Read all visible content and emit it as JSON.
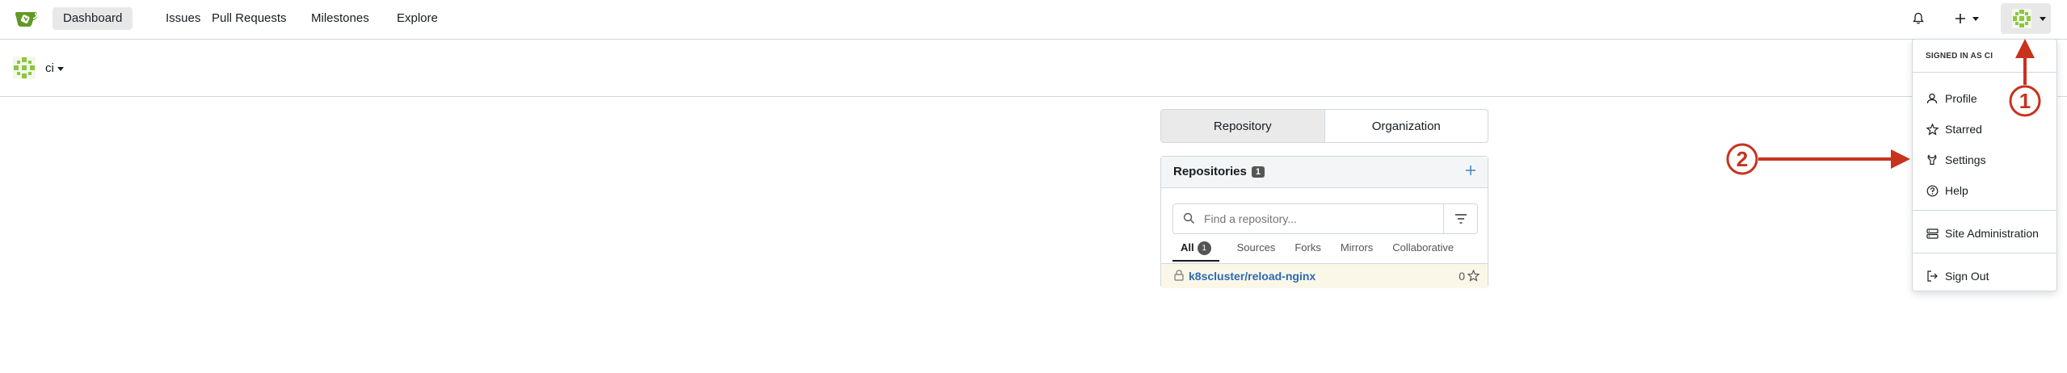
{
  "nav": {
    "items": [
      {
        "label": "Dashboard",
        "active": true
      },
      {
        "label": "Issues"
      },
      {
        "label": "Pull Requests"
      },
      {
        "label": "Milestones"
      },
      {
        "label": "Explore"
      }
    ],
    "icons": {
      "notifications": "bell-icon",
      "create": "plus-icon",
      "avatar": "user-avatar"
    }
  },
  "context": {
    "user": "ci"
  },
  "tabs": [
    {
      "label": "Repository",
      "active": true
    },
    {
      "label": "Organization"
    }
  ],
  "repos": {
    "title": "Repositories",
    "count": "1",
    "search_placeholder": "Find a repository...",
    "filters": [
      {
        "label": "All",
        "count": "1",
        "active": true
      },
      {
        "label": "Sources"
      },
      {
        "label": "Forks"
      },
      {
        "label": "Mirrors"
      },
      {
        "label": "Collaborative"
      }
    ],
    "list": [
      {
        "name": "k8scluster/reload-nginx",
        "stars": "0",
        "private": true
      }
    ]
  },
  "user_menu": {
    "header": "SIGNED IN AS CI",
    "items": [
      {
        "label": "Profile",
        "icon": "person-icon"
      },
      {
        "label": "Starred",
        "icon": "star-icon"
      },
      {
        "label": "Settings",
        "icon": "tools-icon"
      },
      {
        "label": "Help",
        "icon": "question-icon"
      },
      {
        "label": "Site Administration",
        "icon": "server-icon"
      },
      {
        "label": "Sign Out",
        "icon": "sign-out-icon"
      }
    ]
  },
  "annotations": {
    "step1": "1",
    "step2": "2",
    "color": "#c8321e"
  },
  "colors": {
    "accent": "#609926",
    "link": "#2a6ab7",
    "highlight_row": "#fbf7e8"
  }
}
